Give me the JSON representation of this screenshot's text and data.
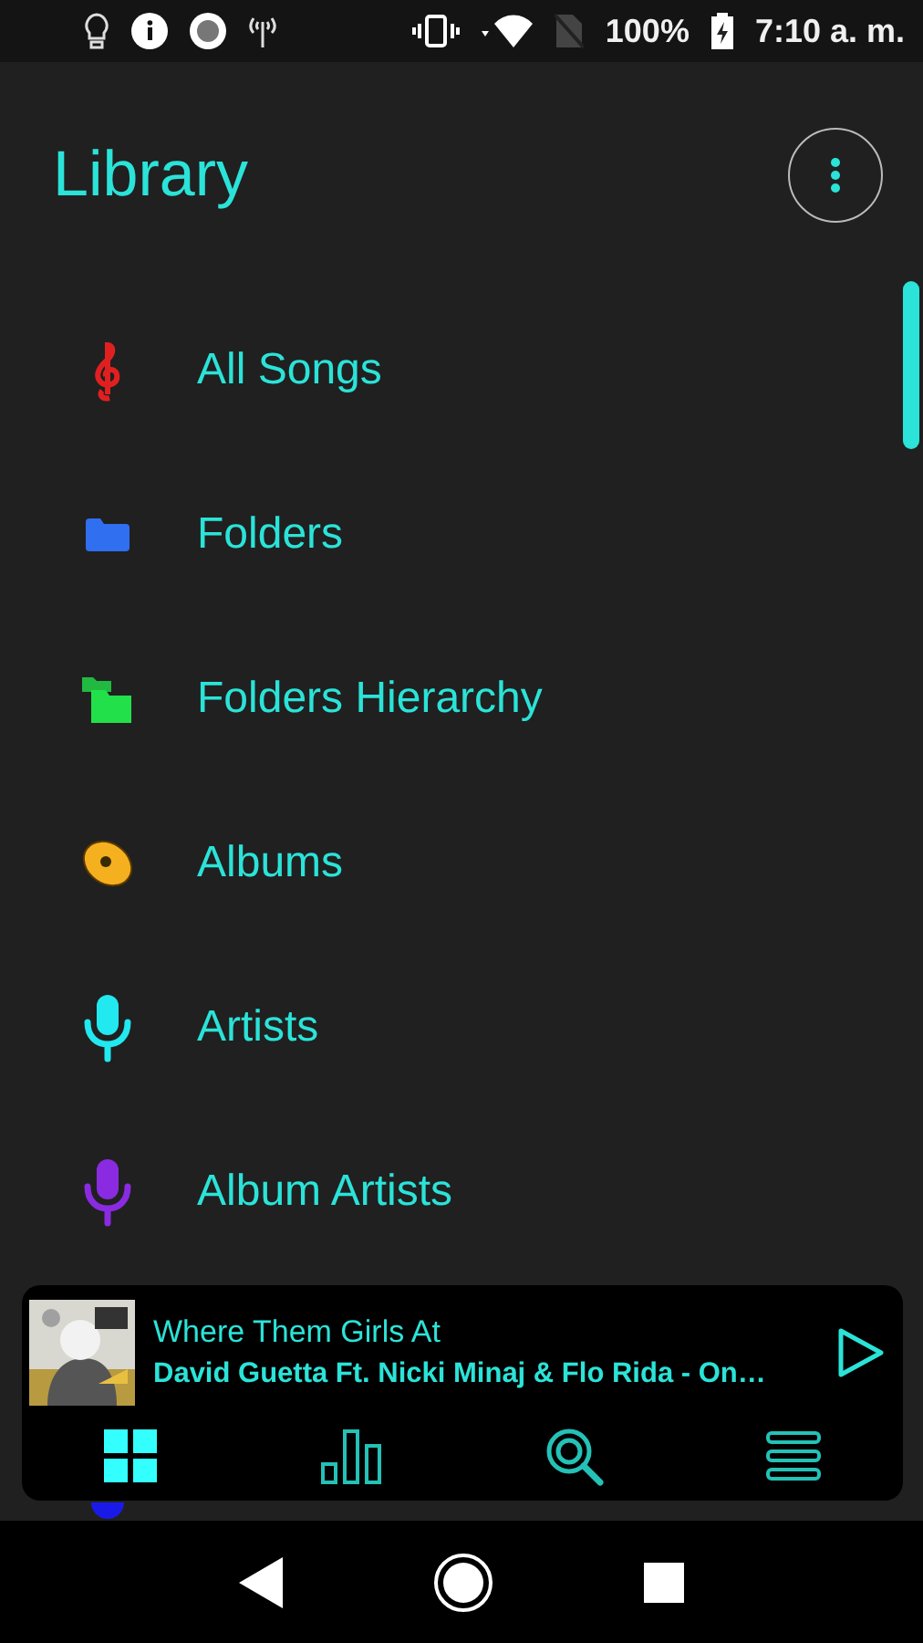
{
  "status_bar": {
    "battery": "100%",
    "time": "7:10 a. m."
  },
  "header": {
    "title": "Library"
  },
  "items": [
    {
      "label": "All Songs",
      "kind": "clef",
      "color": "#e02020"
    },
    {
      "label": "Folders",
      "kind": "folder",
      "color": "#2f6ff0"
    },
    {
      "label": "Folders Hierarchy",
      "kind": "folders",
      "color": "#22e04a"
    },
    {
      "label": "Albums",
      "kind": "disc",
      "color": "#f5b020"
    },
    {
      "label": "Artists",
      "kind": "mic",
      "color": "#22e8f0"
    },
    {
      "label": "Album Artists",
      "kind": "mic",
      "color": "#8a2be2"
    },
    {
      "kind": "dot",
      "color": "#1a1ae8"
    }
  ],
  "now_playing": {
    "title": "Where Them Girls At",
    "subtitle": "David Guetta Ft. Nicki Minaj & Flo Rida - On…"
  },
  "tabs": [
    {
      "kind": "grid",
      "selected": true
    },
    {
      "kind": "bars",
      "selected": false
    },
    {
      "kind": "search",
      "selected": false
    },
    {
      "kind": "menu",
      "selected": false
    }
  ]
}
